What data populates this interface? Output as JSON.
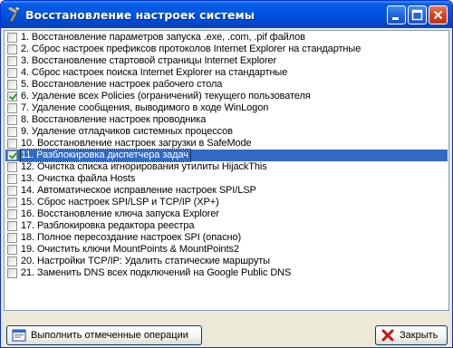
{
  "window": {
    "title": "Восстановление настроек системы"
  },
  "items": [
    {
      "label": "1. Восстановление параметров запуска .exe, .com, .pif файлов",
      "checked": false,
      "selected": false
    },
    {
      "label": "2. Сброс настроек префиксов протоколов Internet Explorer на стандартные",
      "checked": false,
      "selected": false
    },
    {
      "label": "3. Восстановление стартовой страницы Internet Explorer",
      "checked": false,
      "selected": false
    },
    {
      "label": "4. Сброс настроек поиска Internet Explorer на стандартные",
      "checked": false,
      "selected": false
    },
    {
      "label": "5. Восстановление настроек рабочего стола",
      "checked": false,
      "selected": false
    },
    {
      "label": "6. Удаление всех Policies (ограничений) текущего пользователя",
      "checked": true,
      "selected": false
    },
    {
      "label": "7. Удаление сообщения, выводимого в ходе WinLogon",
      "checked": false,
      "selected": false
    },
    {
      "label": "8. Восстановление настроек проводника",
      "checked": false,
      "selected": false
    },
    {
      "label": "9. Удаление отладчиков системных процессов",
      "checked": false,
      "selected": false
    },
    {
      "label": "10. Восстановление настроек загрузки в SafeMode",
      "checked": false,
      "selected": false
    },
    {
      "label": "11. Разблокировка диспетчера задач",
      "checked": true,
      "selected": true
    },
    {
      "label": "12. Очистка списка игнорирования утилиты HijackThis",
      "checked": false,
      "selected": false
    },
    {
      "label": "13. Очистка файла Hosts",
      "checked": false,
      "selected": false
    },
    {
      "label": "14. Автоматическое исправление настроек SPI/LSP",
      "checked": false,
      "selected": false
    },
    {
      "label": "15. Сброс настроек SPI/LSP и TCP/IP (XP+)",
      "checked": false,
      "selected": false
    },
    {
      "label": "16. Восстановление ключа запуска Explorer",
      "checked": false,
      "selected": false
    },
    {
      "label": "17. Разблокировка редактора реестра",
      "checked": false,
      "selected": false
    },
    {
      "label": "18. Полное пересоздание настроек SPI (опасно)",
      "checked": false,
      "selected": false
    },
    {
      "label": "19. Очистить ключи MountPoints & MountPoints2",
      "checked": false,
      "selected": false
    },
    {
      "label": "20. Настройки TCP/IP: Удалить статические маршруты",
      "checked": false,
      "selected": false
    },
    {
      "label": "21. Заменить DNS всех подключений на Google Public DNS",
      "checked": false,
      "selected": false
    }
  ],
  "buttons": {
    "run_label": "Выполнить отмеченные операции",
    "close_label": "Закрыть"
  },
  "icons": {
    "title": "hammer-icon",
    "run": "window-icon",
    "close": "red-x-icon"
  },
  "colors": {
    "titlebar": "#0054e3",
    "selection": "#316ac5",
    "check": "#21a121",
    "close_button": "#d6411f"
  }
}
